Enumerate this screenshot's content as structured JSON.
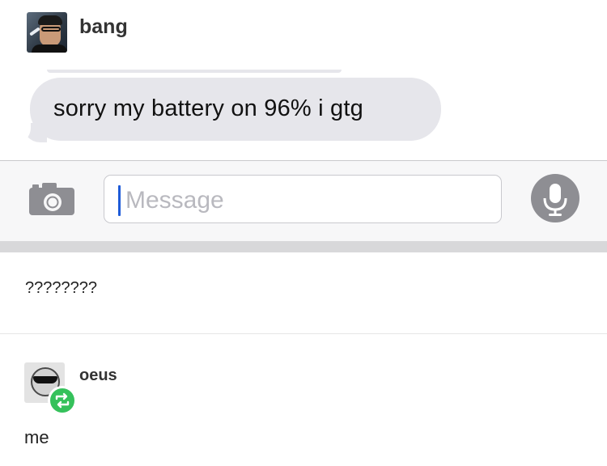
{
  "post": {
    "username": "bang",
    "screenshot": {
      "bubble_text": "sorry my battery on 96% i gtg",
      "input_placeholder": "Message",
      "icons": [
        "camera-icon",
        "microphone-icon"
      ]
    },
    "caption": "????????"
  },
  "reblog": {
    "username": "oeus",
    "body": "me",
    "badge_icon": "reblog-icon",
    "badge_color": "#35c15b"
  }
}
